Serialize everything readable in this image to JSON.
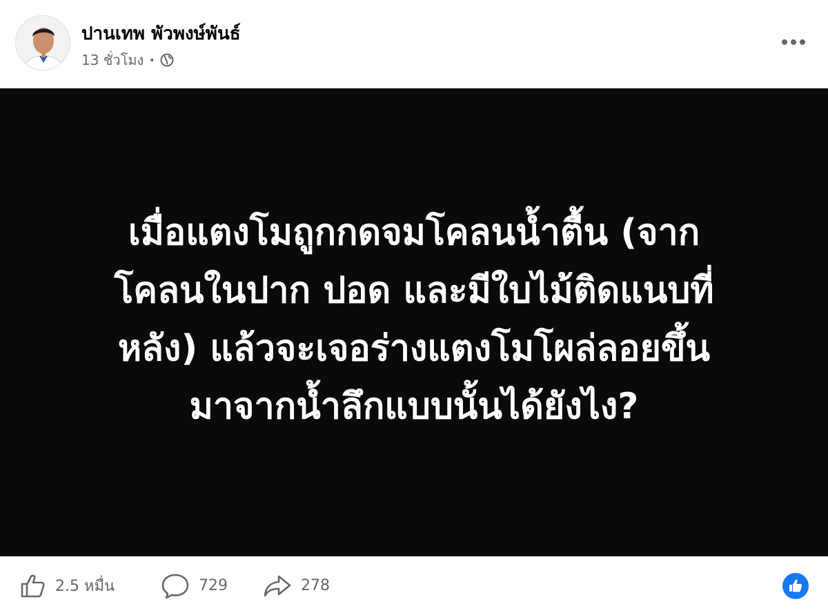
{
  "post": {
    "author_name": "ปานเทพ พัวพงษ์พันธ์",
    "timestamp": "13 ชั่วโมง",
    "separator": "·",
    "privacy_icon": "globe-icon",
    "more_icon": "more-options-icon"
  },
  "image_text": {
    "lines": [
      "เมื่อแตงโมถูกกดจมโคลนน้ำตื้น (จาก",
      "โคลนในปาก ปอด และมีใบไม้ติดแนบที่",
      "หลัง) แล้วจะเจอร่างแตงโมโผล่ลอยขึ้น",
      "มาจากน้ำลึกแบบนั้นได้ยังไง?"
    ],
    "background_color": "#0a0a0a",
    "text_color": "#ffffff"
  },
  "footer": {
    "likes_label": "2.5 หมื่น",
    "comments_label": "729",
    "shares_label": "278",
    "reaction_icon": "like-reaction-icon",
    "accent_color": "#1877f2"
  }
}
